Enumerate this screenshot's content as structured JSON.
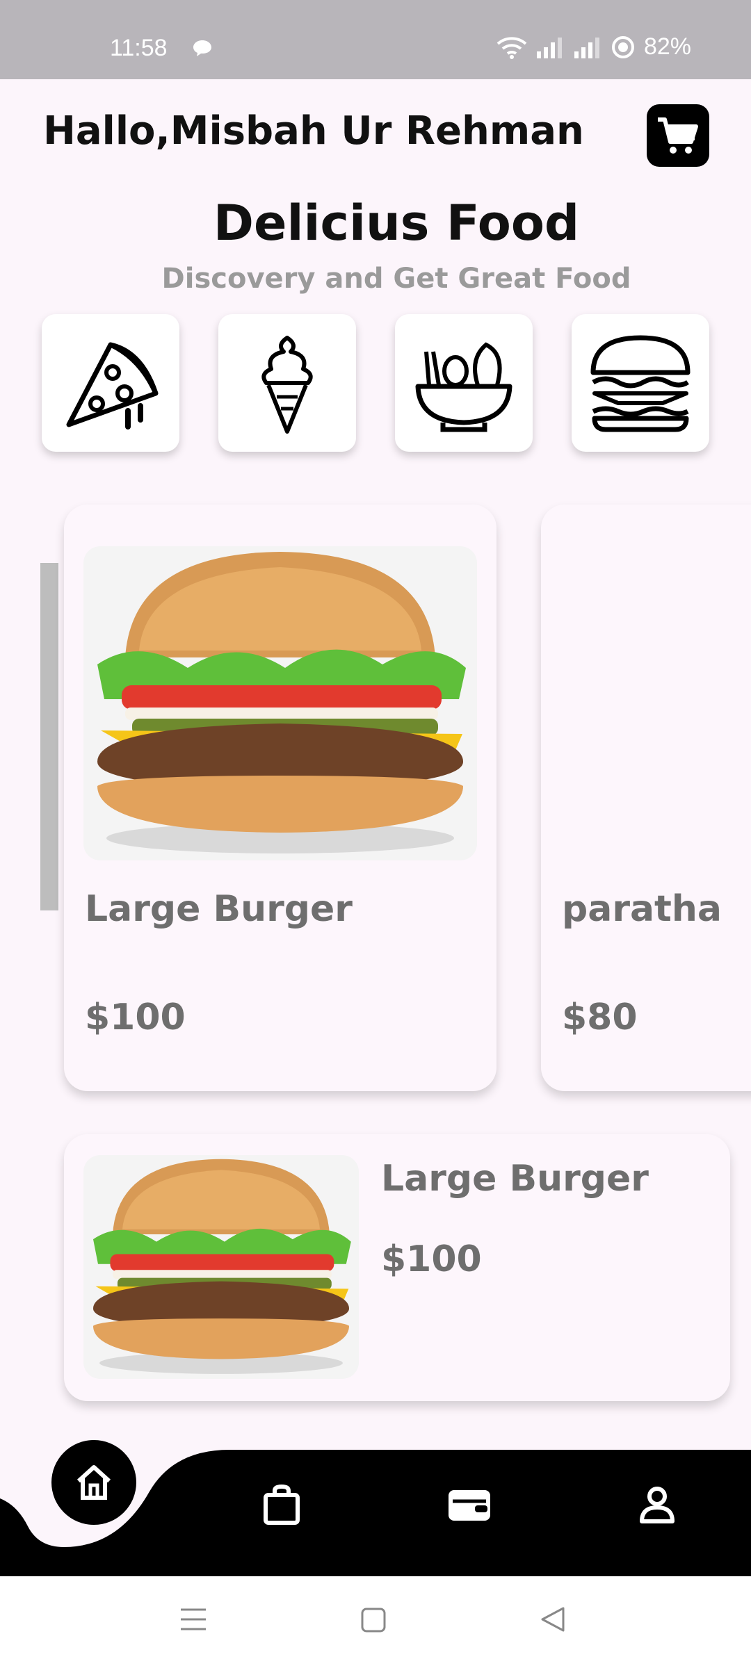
{
  "status_bar": {
    "time": "11:58",
    "battery": "82%"
  },
  "header": {
    "greeting": "Hallo,Misbah Ur Rehman"
  },
  "hero": {
    "title": "Delicius Food",
    "subtitle": "Discovery and Get Great Food"
  },
  "categories": [
    {
      "icon": "pizza-icon"
    },
    {
      "icon": "ice-cream-icon"
    },
    {
      "icon": "salad-bowl-icon"
    },
    {
      "icon": "burger-icon"
    }
  ],
  "featured": [
    {
      "name": "Large Burger",
      "price": "$100"
    },
    {
      "name": "paratha",
      "price": "$80"
    }
  ],
  "list": [
    {
      "name": "Large Burger",
      "price": "$100"
    }
  ],
  "nav": {
    "items": [
      "home-icon",
      "shopping-bag-icon",
      "wallet-icon",
      "profile-icon"
    ]
  },
  "colors": {
    "accent": "#000000",
    "background": "#fcf5fb",
    "text_muted": "#6e6e6e"
  }
}
